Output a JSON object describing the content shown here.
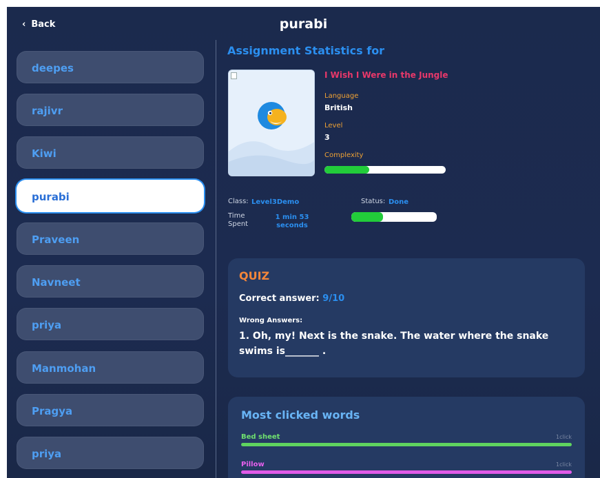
{
  "header": {
    "back_label": "Back",
    "title": "purabi"
  },
  "sidebar": {
    "students": [
      {
        "name": "deepes",
        "active": false
      },
      {
        "name": "rajivr",
        "active": false
      },
      {
        "name": "Kiwi",
        "active": false
      },
      {
        "name": "purabi",
        "active": true
      },
      {
        "name": "Praveen",
        "active": false
      },
      {
        "name": "Navneet",
        "active": false
      },
      {
        "name": "priya",
        "active": false
      },
      {
        "name": "Manmohan",
        "active": false
      },
      {
        "name": "Pragya",
        "active": false
      },
      {
        "name": "priya",
        "active": false
      }
    ]
  },
  "assignment": {
    "heading": "Assignment Statistics for",
    "book_title": "I Wish I Were in the Jungle",
    "language_label": "Language",
    "language_value": "British",
    "level_label": "Level",
    "level_value": "3",
    "complexity_label": "Complexity",
    "complexity_fraction": 0.37,
    "class_label": "Class:",
    "class_value": "Level3Demo",
    "status_label": "Status:",
    "status_value": "Done",
    "status_fraction": 0.37,
    "time_label_1": "Time",
    "time_label_2": "Spent",
    "time_value_1": "1 min 53",
    "time_value_2": "seconds",
    "book_icon": "bird-icon"
  },
  "quiz": {
    "title": "QUIZ",
    "correct_label": "Correct answer:",
    "correct_value": "9/10",
    "wrong_label": "Wrong Answers:",
    "wrong_question": "1. Oh, my! Next is the snake. The water where the snake swims is_______ ."
  },
  "words": {
    "title": "Most clicked words",
    "items": [
      {
        "word": "Bed sheet",
        "count": "1",
        "unit": "click",
        "color": "#5fd45f"
      },
      {
        "word": "Pillow",
        "count": "1",
        "unit": "click",
        "color": "#e05ae8"
      }
    ]
  },
  "colors": {
    "accent_blue": "#2b8ff0",
    "progress_green": "#22cc3a",
    "book_title_pink": "#e8386a",
    "meta_orange": "#f0a234",
    "quiz_orange": "#f3863a"
  }
}
